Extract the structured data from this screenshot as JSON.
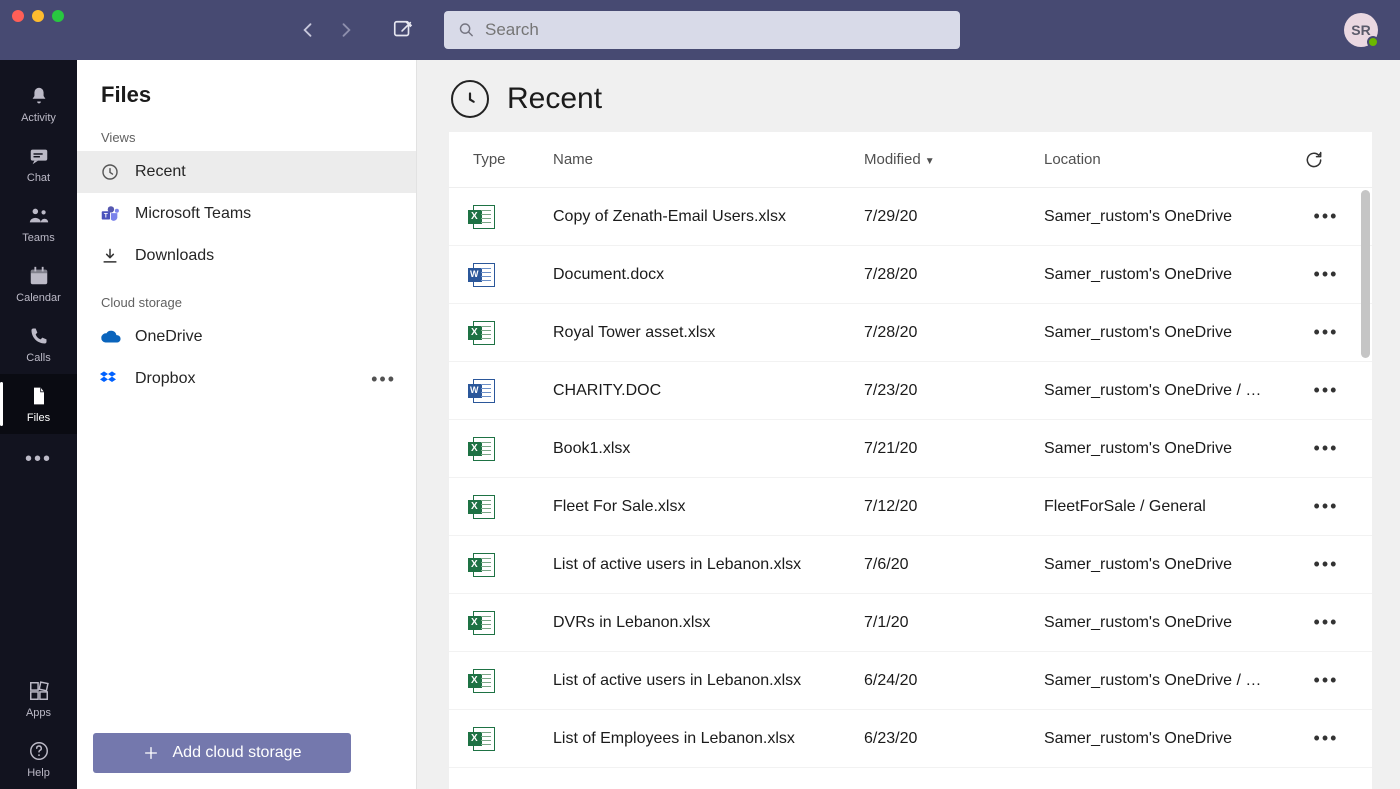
{
  "search": {
    "placeholder": "Search"
  },
  "avatar": {
    "initials": "SR"
  },
  "rail": {
    "items": [
      {
        "key": "activity",
        "label": "Activity"
      },
      {
        "key": "chat",
        "label": "Chat"
      },
      {
        "key": "teams",
        "label": "Teams"
      },
      {
        "key": "calendar",
        "label": "Calendar"
      },
      {
        "key": "calls",
        "label": "Calls"
      },
      {
        "key": "files",
        "label": "Files"
      }
    ],
    "apps_label": "Apps",
    "help_label": "Help"
  },
  "filespane": {
    "title": "Files",
    "section_views": "Views",
    "section_cloud": "Cloud storage",
    "views": [
      {
        "key": "recent",
        "label": "Recent"
      },
      {
        "key": "msteams",
        "label": "Microsoft Teams"
      },
      {
        "key": "downloads",
        "label": "Downloads"
      }
    ],
    "cloud": [
      {
        "key": "onedrive",
        "label": "OneDrive"
      },
      {
        "key": "dropbox",
        "label": "Dropbox"
      }
    ],
    "add_storage_label": "Add cloud storage"
  },
  "main": {
    "title": "Recent",
    "columns": {
      "type": "Type",
      "name": "Name",
      "modified": "Modified",
      "location": "Location"
    },
    "rows": [
      {
        "type": "xlsx",
        "name": "Copy of Zenath-Email Users.xlsx",
        "modified": "7/29/20",
        "location": "Samer_rustom's OneDrive"
      },
      {
        "type": "docx",
        "name": "Document.docx",
        "modified": "7/28/20",
        "location": "Samer_rustom's OneDrive"
      },
      {
        "type": "xlsx",
        "name": "Royal Tower asset.xlsx",
        "modified": "7/28/20",
        "location": "Samer_rustom's OneDrive"
      },
      {
        "type": "docx",
        "name": "CHARITY.DOC",
        "modified": "7/23/20",
        "location": "Samer_rustom's OneDrive / …"
      },
      {
        "type": "xlsx",
        "name": "Book1.xlsx",
        "modified": "7/21/20",
        "location": "Samer_rustom's OneDrive"
      },
      {
        "type": "xlsx",
        "name": "Fleet For Sale.xlsx",
        "modified": "7/12/20",
        "location": "FleetForSale / General"
      },
      {
        "type": "xlsx",
        "name": "List of active users in Lebanon.xlsx",
        "modified": "7/6/20",
        "location": "Samer_rustom's OneDrive"
      },
      {
        "type": "xlsx",
        "name": "DVRs in Lebanon.xlsx",
        "modified": "7/1/20",
        "location": "Samer_rustom's OneDrive"
      },
      {
        "type": "xlsx",
        "name": "List of active users in Lebanon.xlsx",
        "modified": "6/24/20",
        "location": "Samer_rustom's OneDrive / …"
      },
      {
        "type": "xlsx",
        "name": "List of Employees in Lebanon.xlsx",
        "modified": "6/23/20",
        "location": "Samer_rustom's OneDrive"
      }
    ]
  }
}
